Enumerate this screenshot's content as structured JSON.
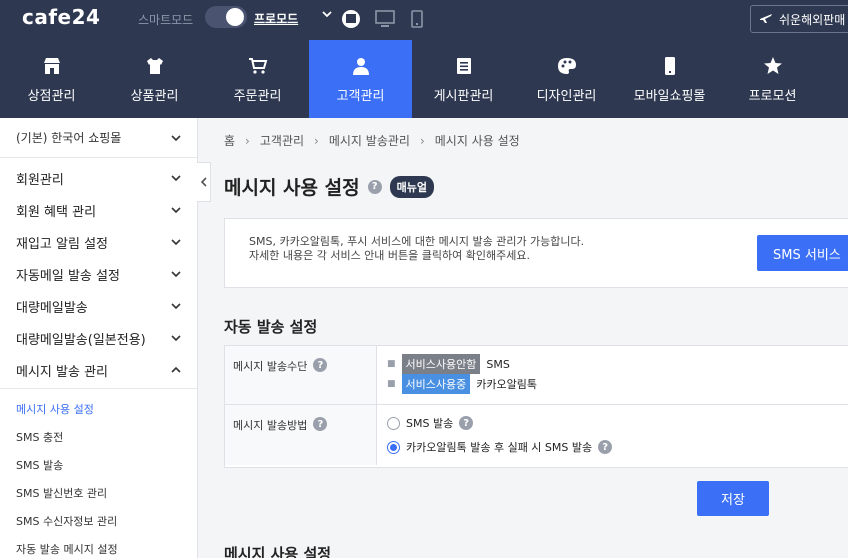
{
  "topbar": {
    "logo": "cafe24",
    "smart_mode": "스마트모드",
    "pro_mode": "프로모드",
    "global_button": "쉬운해외판매"
  },
  "mainnav": [
    {
      "label": "상점관리",
      "icon": "store-icon"
    },
    {
      "label": "상품관리",
      "icon": "shirt-icon"
    },
    {
      "label": "주문관리",
      "icon": "cart-icon"
    },
    {
      "label": "고객관리",
      "icon": "person-icon",
      "active": true
    },
    {
      "label": "게시판관리",
      "icon": "board-icon"
    },
    {
      "label": "디자인관리",
      "icon": "palette-icon"
    },
    {
      "label": "모바일쇼핑몰",
      "icon": "mobile-icon"
    },
    {
      "label": "프로모션",
      "icon": "star-icon"
    }
  ],
  "sidebar": {
    "shop_selector": "(기본) 한국어 쇼핑몰",
    "items": [
      {
        "label": "회원관리"
      },
      {
        "label": "회원 혜택 관리"
      },
      {
        "label": "재입고 알림 설정"
      },
      {
        "label": "자동메일 발송 설정"
      },
      {
        "label": "대량메일발송"
      },
      {
        "label": "대량메일발송(일본전용)"
      },
      {
        "label": "메시지 발송 관리"
      }
    ],
    "subitems": [
      {
        "label": "메시지 사용 설정"
      },
      {
        "label": "SMS 충전"
      },
      {
        "label": "SMS 발송"
      },
      {
        "label": "SMS 발신번호 관리"
      },
      {
        "label": "SMS 수신자정보 관리"
      },
      {
        "label": "자동 발송 메시지 설정"
      }
    ]
  },
  "breadcrumb": [
    "홈",
    "고객관리",
    "메시지 발송관리",
    "메시지 사용 설정"
  ],
  "page": {
    "title": "메시지 사용 설정",
    "help": "?",
    "manual_badge": "매뉴얼"
  },
  "info": {
    "line1": "SMS, 카카오알림톡, 푸시 서비스에 대한 메시지 발송 관리가 가능합니다.",
    "line2": "자세한 내용은 각 서비스 안내 버튼을 클릭하여 확인해주세요.",
    "sms_button": "SMS 서비스"
  },
  "auto_section": {
    "title": "자동 발송 설정",
    "method_label": "메시지 발송수단",
    "methods": [
      {
        "status": "서비스사용안함",
        "name": "SMS"
      },
      {
        "status": "서비스사용중",
        "name": "카카오알림톡"
      }
    ],
    "way_label": "메시지 발송방법",
    "ways": [
      {
        "label": "SMS 발송",
        "checked": false
      },
      {
        "label": "카카오알림톡 발송 후 실패 시 SMS 발송",
        "checked": true
      }
    ],
    "save_button": "저장"
  },
  "next_section": {
    "title": "메시지 사용 설정"
  }
}
